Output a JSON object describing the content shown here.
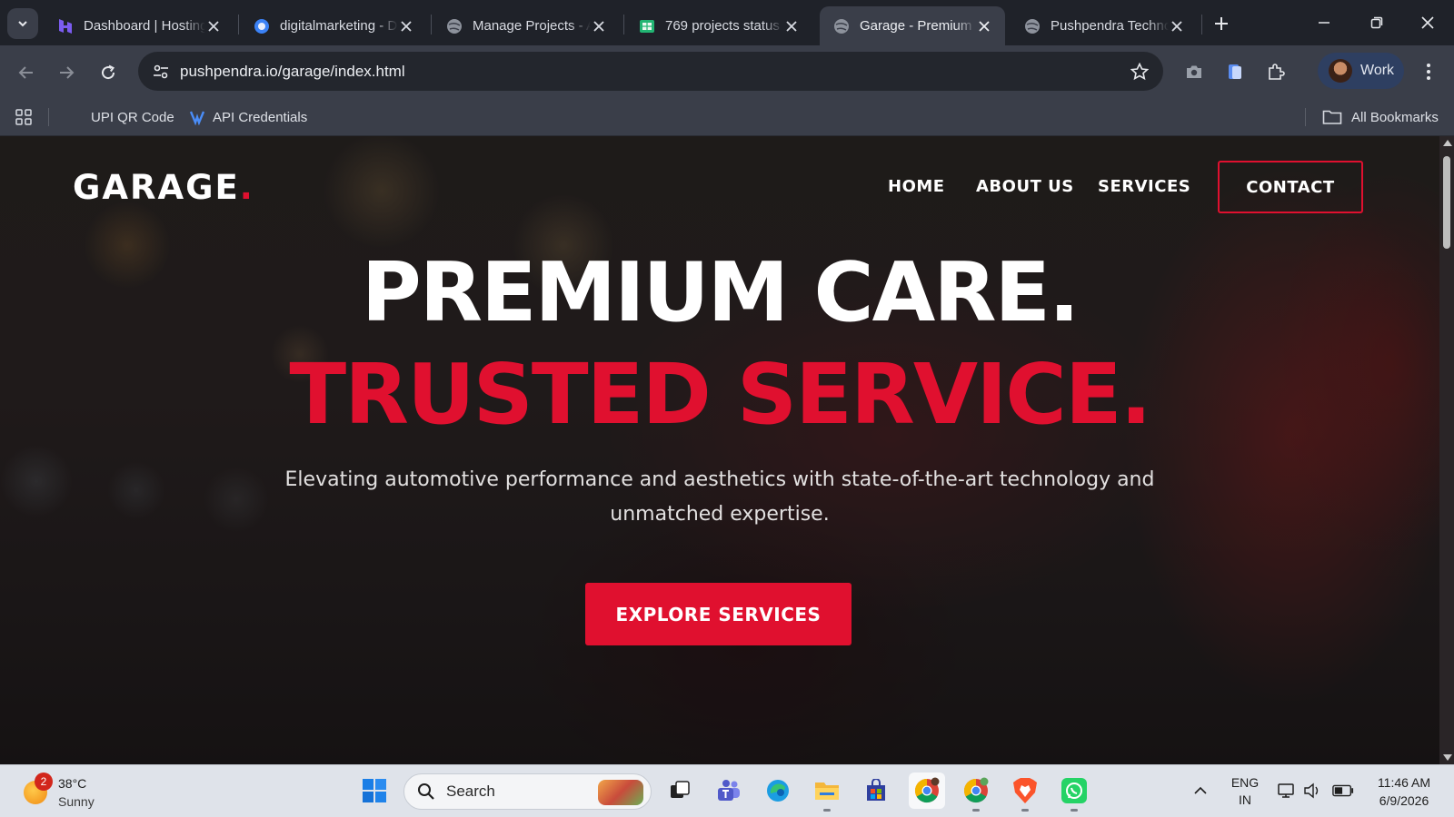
{
  "browser": {
    "tabs": [
      {
        "title": "Dashboard | Hostinger",
        "icon": "hostinger-icon"
      },
      {
        "title": "digitalmarketing - Dashboard",
        "icon": "globe-blue-icon"
      },
      {
        "title": "Manage Projects - Admin",
        "icon": "globe-icon"
      },
      {
        "title": "769 projects status",
        "icon": "sheets-icon"
      },
      {
        "title": "Garage - Premium Care",
        "icon": "globe-icon",
        "active": true
      },
      {
        "title": "Pushpendra Technologies",
        "icon": "globe-icon"
      }
    ],
    "url": "pushpendra.io/garage/index.html",
    "profile_name": "Work",
    "bookmarks": [
      {
        "label": "UPI QR Code"
      },
      {
        "label": "API Credentials"
      }
    ],
    "all_bookmarks_label": "All Bookmarks"
  },
  "site": {
    "logo_text": "GARAGE",
    "logo_dot": ".",
    "nav": {
      "home": "HOME",
      "about": "ABOUT US",
      "services": "SERVICES",
      "contact": "CONTACT"
    },
    "hero": {
      "headline_line1": "PREMIUM CARE.",
      "headline_line2": "TRUSTED SERVICE.",
      "subtitle": "Elevating automotive performance and aesthetics with state-of-the-art technology and unmatched expertise.",
      "cta_label": "EXPLORE SERVICES"
    },
    "colors": {
      "accent": "#e0102f",
      "text": "#ffffff"
    }
  },
  "taskbar": {
    "weather_badge": "2",
    "weather_temp": "38°C",
    "weather_condition": "Sunny",
    "search_placeholder": "Search",
    "lang_line1": "ENG",
    "lang_line2": "IN",
    "time": "11:46 AM",
    "date": "6/9/2026"
  }
}
